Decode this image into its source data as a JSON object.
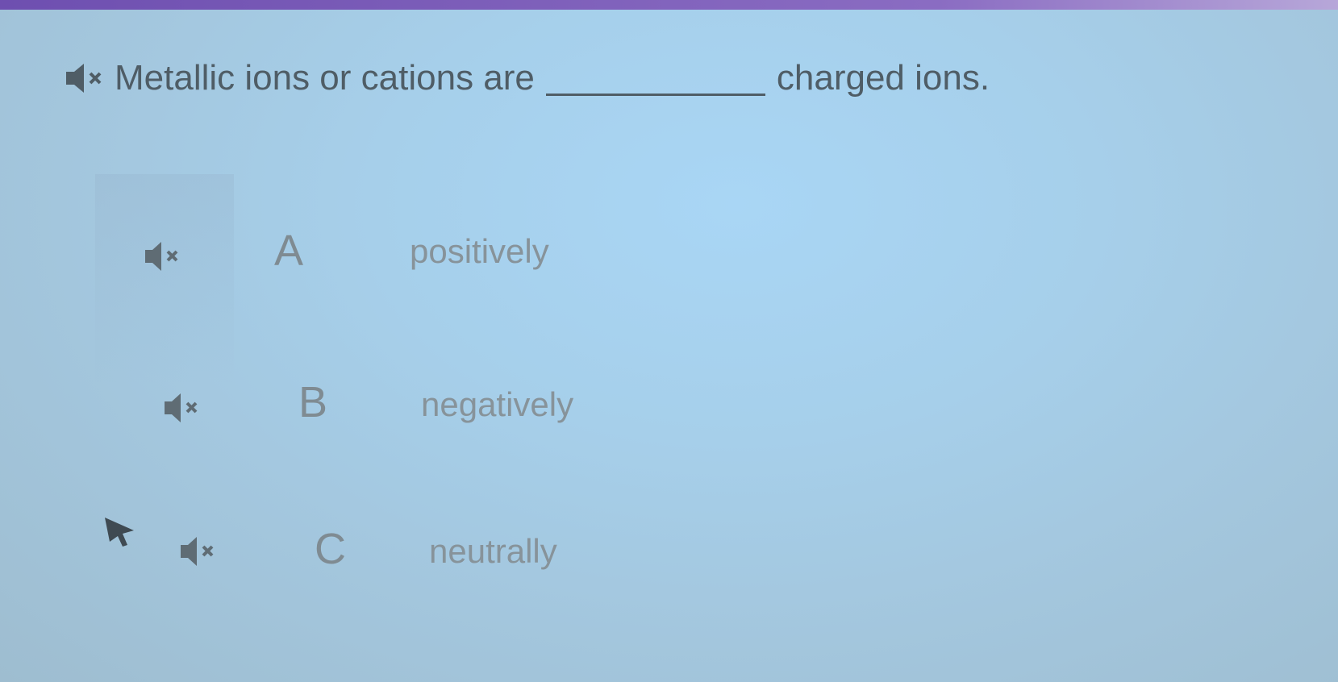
{
  "question": {
    "text_before": "Metallic ions or cations are",
    "blank": "___________",
    "text_after": "charged ions.",
    "icon": "speaker-mute-icon"
  },
  "options": [
    {
      "letter": "A",
      "text": "positively",
      "icon": "speaker-mute-icon"
    },
    {
      "letter": "B",
      "text": "negatively",
      "icon": "speaker-mute-icon"
    },
    {
      "letter": "C",
      "text": "neutrally",
      "icon": "speaker-mute-icon"
    }
  ],
  "colors": {
    "top_bar": "#7a5cb8",
    "background": "#a6cfea",
    "question_text": "#4f5d66",
    "option_text": "#87939a"
  }
}
